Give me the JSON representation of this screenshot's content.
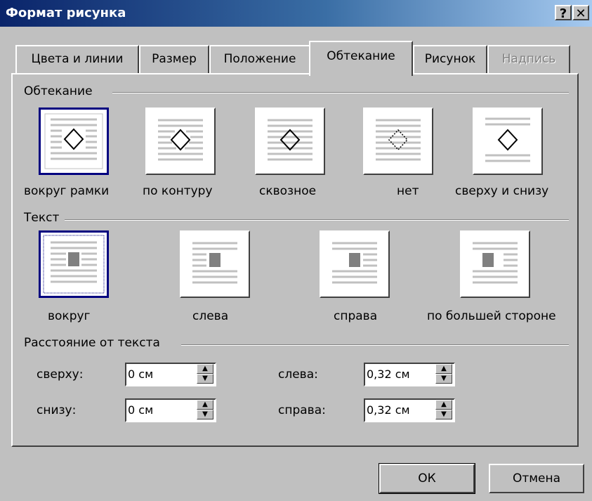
{
  "window": {
    "title": "Формат рисунка",
    "help_label": "?",
    "close_label": "✕"
  },
  "tabs": [
    "Цвета и линии",
    "Размер",
    "Положение",
    "Обтекание",
    "Рисунок",
    "Надпись"
  ],
  "wrap_group": {
    "title": "Обтекание",
    "options": [
      {
        "label": "вокруг рамки"
      },
      {
        "label": "по контуру"
      },
      {
        "label": "сквозное"
      },
      {
        "label": "нет"
      },
      {
        "label": "сверху и снизу"
      }
    ]
  },
  "text_group": {
    "title": "Текст",
    "options": [
      {
        "label": "вокруг"
      },
      {
        "label": "слева"
      },
      {
        "label": "справа"
      },
      {
        "label": "по большей стороне"
      }
    ]
  },
  "distance_group": {
    "title": "Расстояние от текста",
    "top_label": "сверху:",
    "top_value": "0 см",
    "bottom_label": "снизу:",
    "bottom_value": "0 см",
    "left_label": "слева:",
    "left_value": "0,32 см",
    "right_label": "справа:",
    "right_value": "0,32 см"
  },
  "buttons": {
    "ok": "ОК",
    "cancel": "Отмена"
  },
  "colors": {
    "selection": "#000080",
    "title_start": "#0a246a",
    "title_end": "#a6caf0"
  }
}
